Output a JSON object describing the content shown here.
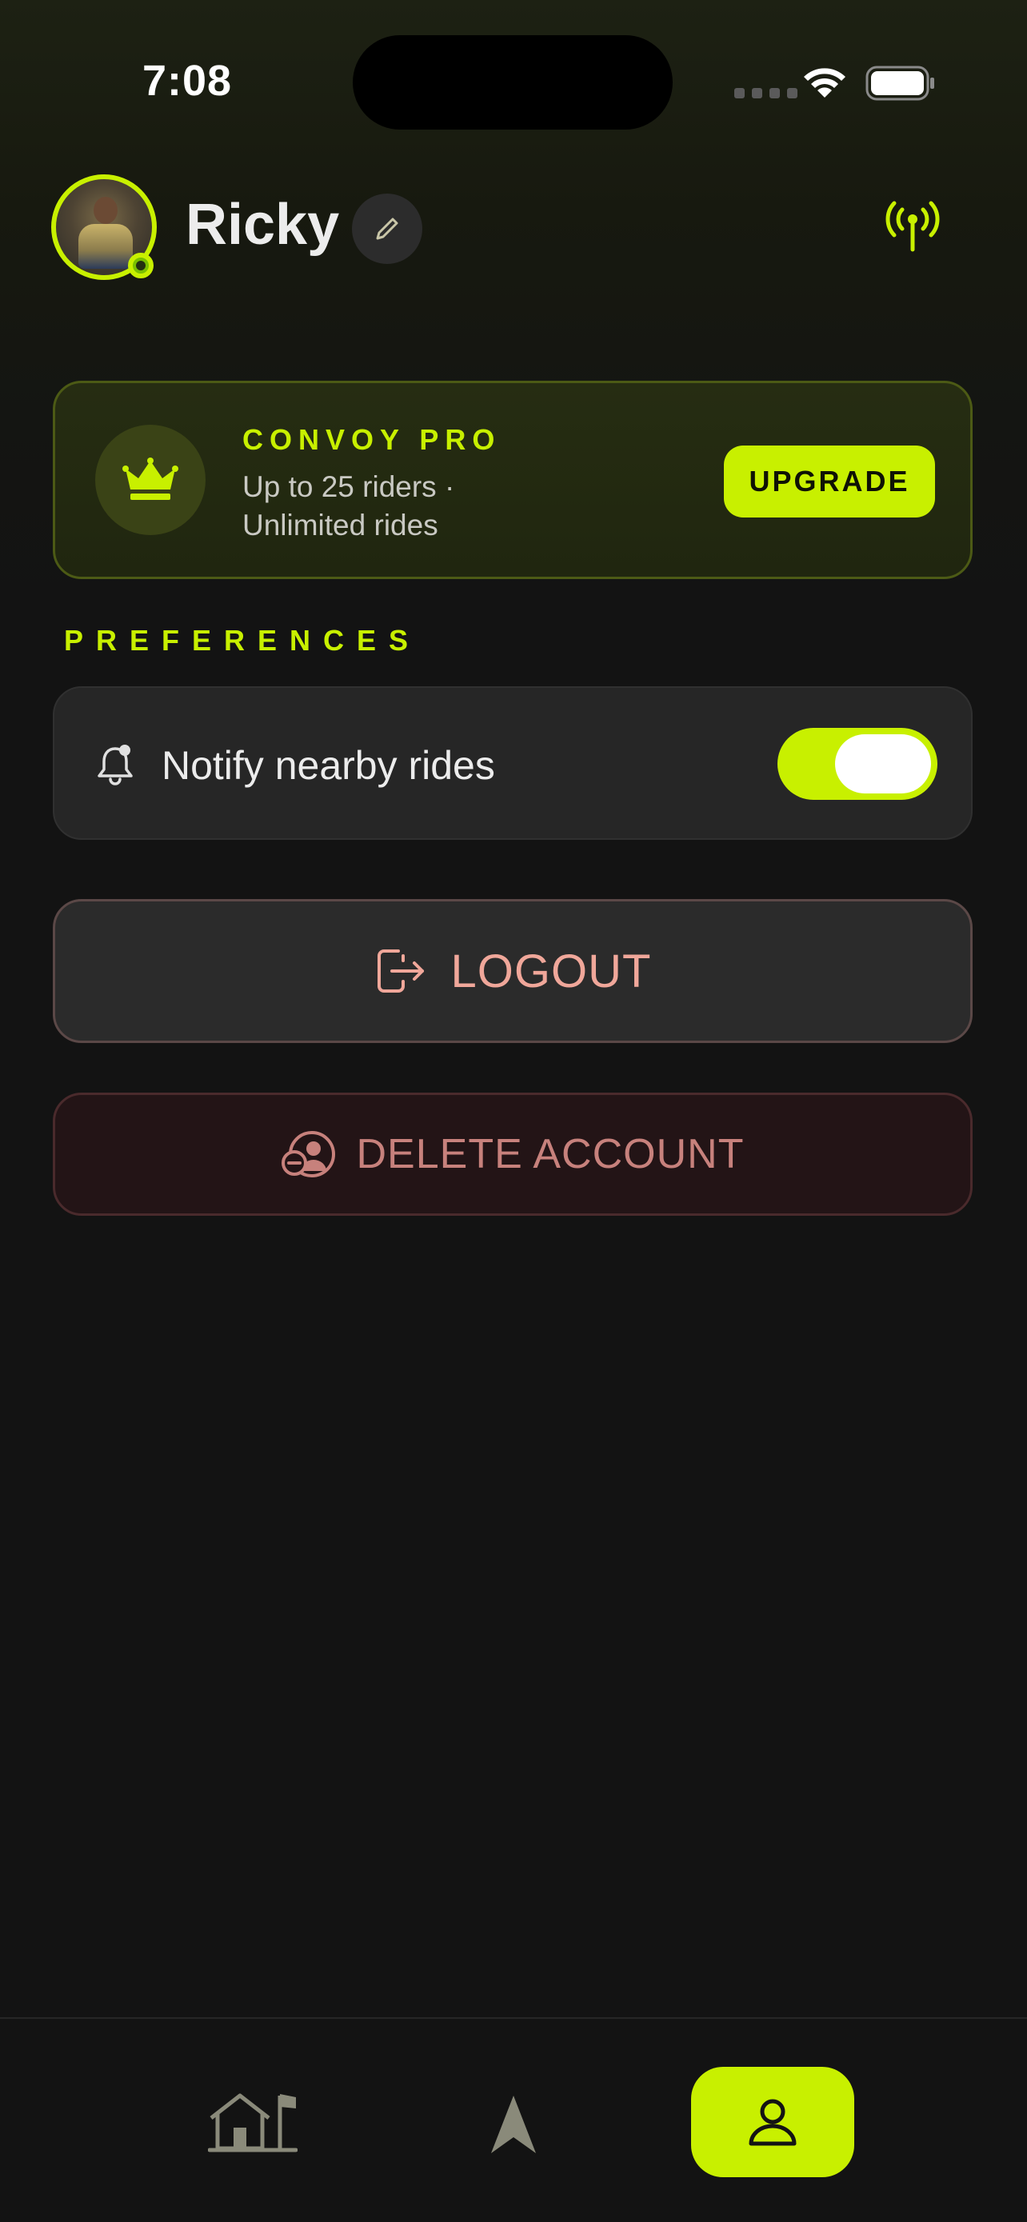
{
  "status_bar": {
    "time": "7:08",
    "icons": [
      "signal-icon",
      "wifi-icon",
      "battery-icon"
    ]
  },
  "header": {
    "username": "Ricky",
    "avatar_icon": "profile-photo",
    "edit_icon": "pencil-icon",
    "broadcast_icon": "broadcast-antenna-icon"
  },
  "pro_card": {
    "icon": "crown-icon",
    "title": "CONVOY PRO",
    "subtitle": "Up to 25 riders · Unlimited rides",
    "button_label": "UPGRADE"
  },
  "preferences": {
    "section_label": "PREFERENCES",
    "items": [
      {
        "icon": "bell-icon",
        "label": "Notify nearby rides",
        "enabled": true
      }
    ]
  },
  "actions": {
    "logout_label": "LOGOUT",
    "logout_icon": "logout-icon",
    "delete_label": "DELETE ACCOUNT",
    "delete_icon": "delete-user-icon"
  },
  "tab_bar": {
    "tabs": [
      {
        "icon": "home-flag-icon",
        "active": false
      },
      {
        "icon": "navigation-arrow-icon",
        "active": false
      },
      {
        "icon": "profile-icon",
        "active": true
      }
    ]
  },
  "colors": {
    "accent": "#c8f000",
    "background": "#131313",
    "logout_text": "#f0a79a",
    "delete_text": "#c7817c"
  }
}
